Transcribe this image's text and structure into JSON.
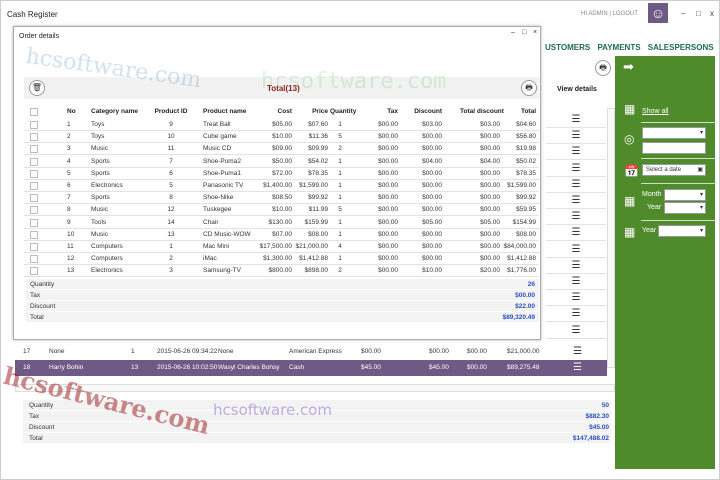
{
  "app": {
    "title": "Cash Register",
    "greeting": "HI ADMIN",
    "separator": "|",
    "logout": "LOGOUT",
    "logo": "smiley-logo"
  },
  "nav": {
    "items": [
      "USTOMERS",
      "PAYMENTS",
      "SALESPERSONS"
    ]
  },
  "background_table": {
    "view_details_header": "View details",
    "rows": [
      {
        "no": "17",
        "customer": "None",
        "items": "1",
        "date": "2015-06-26 09:34:22",
        "salesperson": "None",
        "payment": "American Express",
        "tax": "$00.00",
        "discount": "$00.00",
        "c3": "$00.00",
        "total": "$21,000.00",
        "selected": false
      },
      {
        "no": "18",
        "customer": "Harry Bohin",
        "items": "13",
        "date": "2015-06-26 10:02:50",
        "salesperson": "Wasyl Charles Bohsy",
        "payment": "Cash",
        "tax": "$45.00",
        "discount": "$45.00",
        "c3": "$00.00",
        "total": "$89,275.48",
        "selected": true
      }
    ],
    "summary": [
      {
        "label": "Quantity",
        "value": "50"
      },
      {
        "label": "Tax",
        "value": "$882.30"
      },
      {
        "label": "Discount",
        "value": "$45.00"
      },
      {
        "label": "Total",
        "value": "$147,488.02"
      }
    ]
  },
  "filter_panel": {
    "show_all": "Show all",
    "date_placeholder": "Select a date",
    "month_label": "Month",
    "year_label": "Year",
    "year_label2": "Year"
  },
  "order_details": {
    "title": "Order details",
    "total_title": "Total(13)",
    "columns": [
      "No",
      "Category name",
      "Product ID",
      "Product name",
      "Cost",
      "Price",
      "Quantity",
      "Tax",
      "Discount",
      "Total discount",
      "Total"
    ],
    "rows": [
      [
        "1",
        "Toys",
        "9",
        "Treat Ball",
        "$05.00",
        "$07.60",
        "1",
        "$00.00",
        "$03.00",
        "$03.00",
        "$04.60"
      ],
      [
        "2",
        "Toys",
        "10",
        "Cube game",
        "$10.00",
        "$11.36",
        "5",
        "$00.00",
        "$00.00",
        "$00.00",
        "$56.80"
      ],
      [
        "3",
        "Music",
        "11",
        "Music CD",
        "$09.00",
        "$09.99",
        "2",
        "$00.00",
        "$00.00",
        "$00.00",
        "$19.98"
      ],
      [
        "4",
        "Sports",
        "7",
        "Shoe-Puma2",
        "$50.00",
        "$54.02",
        "1",
        "$00.00",
        "$04.00",
        "$04.00",
        "$50.02"
      ],
      [
        "5",
        "Sports",
        "6",
        "Shoe-Puma1",
        "$72.00",
        "$78.35",
        "1",
        "$00.00",
        "$00.00",
        "$00.00",
        "$78.35"
      ],
      [
        "6",
        "Electronics",
        "5",
        "Panasonic TV",
        "$1,400.00",
        "$1,599.00",
        "1",
        "$00.00",
        "$00.00",
        "$00.00",
        "$1,599.00"
      ],
      [
        "7",
        "Sports",
        "8",
        "Shoe-Nike",
        "$08.50",
        "$99.92",
        "1",
        "$00.00",
        "$00.00",
        "$00.00",
        "$99.92"
      ],
      [
        "8",
        "Music",
        "12",
        "Tuskegee",
        "$10.00",
        "$11.99",
        "5",
        "$00.00",
        "$00.00",
        "$00.00",
        "$59.95"
      ],
      [
        "9",
        "Tools",
        "14",
        "Chair",
        "$130.00",
        "$159.99",
        "1",
        "$00.00",
        "$05.00",
        "$05.00",
        "$154.99"
      ],
      [
        "10",
        "Music",
        "13",
        "CD Music-WOW",
        "$07.00",
        "$08.00",
        "1",
        "$00.00",
        "$00.00",
        "$00.00",
        "$08.00"
      ],
      [
        "11",
        "Computers",
        "1",
        "Mac Mini",
        "$17,500.00",
        "$21,000.00",
        "4",
        "$00.00",
        "$00.00",
        "$00.00",
        "$84,000.00"
      ],
      [
        "12",
        "Computers",
        "2",
        "iMac",
        "$1,300.00",
        "$1,412.88",
        "1",
        "$00.00",
        "$00.00",
        "$00.00",
        "$1,412.88"
      ],
      [
        "13",
        "Electronics",
        "3",
        "Samsung-TV",
        "$800.00",
        "$898.00",
        "2",
        "$00.00",
        "$10.00",
        "$20.00",
        "$1,776.00"
      ]
    ],
    "summary": [
      {
        "label": "Quantity",
        "value": "26"
      },
      {
        "label": "Tax",
        "value": "$00.00"
      },
      {
        "label": "Discount",
        "value": "$22.00"
      },
      {
        "label": "Total",
        "value": "$89,320.49"
      }
    ]
  },
  "watermarks": [
    "hcsoftware.com"
  ],
  "colors": {
    "accent_green": "#4f8a2b",
    "selected_row": "#6f5a85",
    "total_title": "#8b1a1a",
    "summary_value": "#2b4fc4",
    "nav": "#1e6b55"
  }
}
